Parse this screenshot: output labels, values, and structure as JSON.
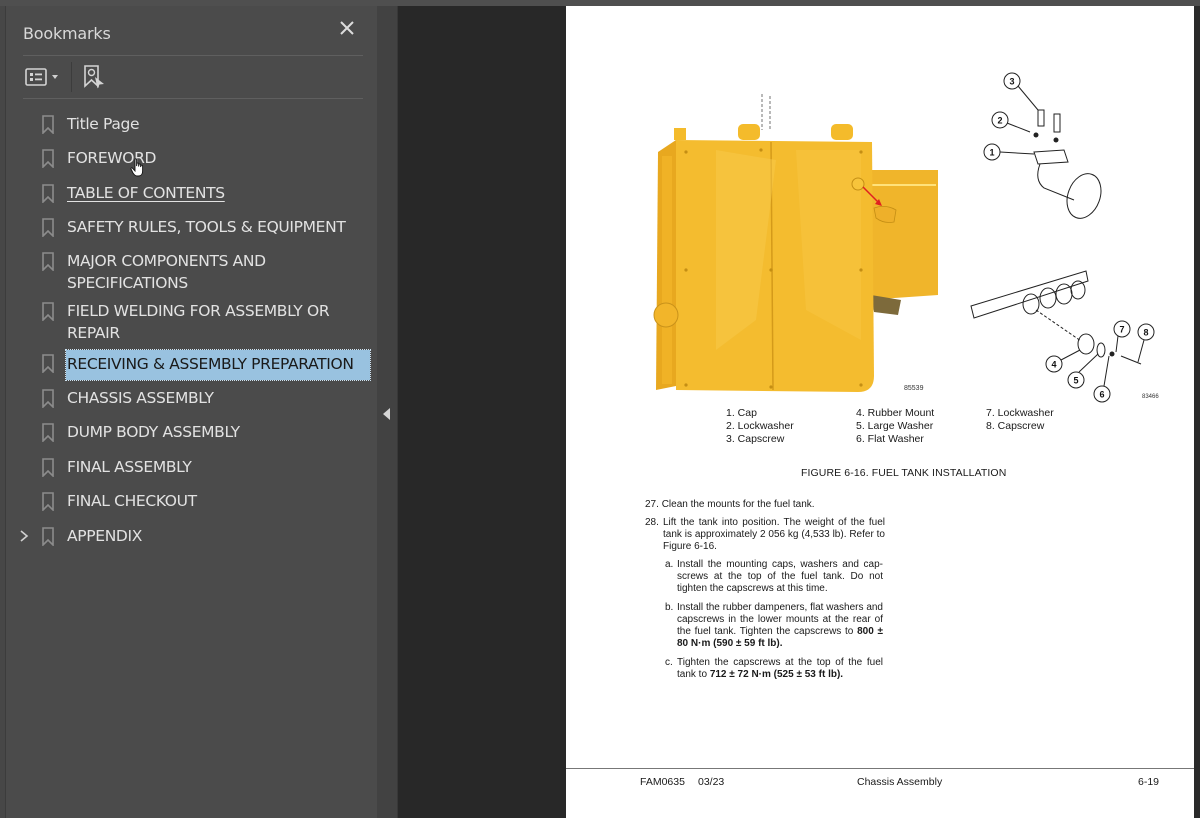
{
  "panel": {
    "title": "Bookmarks",
    "close_icon": "close-icon",
    "toolbar": {
      "options_icon": "list-options-icon",
      "options_dropdown_icon": "caret-down-icon",
      "find_icon": "find-current-bookmark-icon"
    }
  },
  "bookmarks": [
    {
      "label": "Title Page",
      "state": "normal"
    },
    {
      "label": "FOREWORD",
      "state": "hover"
    },
    {
      "label": "TABLE OF CONTENTS",
      "state": "underlined"
    },
    {
      "label": "SAFETY RULES, TOOLS & EQUIPMENT",
      "state": "normal"
    },
    {
      "label": "MAJOR COMPONENTS AND\nSPECIFICATIONS",
      "state": "normal"
    },
    {
      "label": "FIELD WELDING FOR ASSEMBLY OR\nREPAIR",
      "state": "normal"
    },
    {
      "label": "RECEIVING & ASSEMBLY PREPARATION",
      "state": "selected"
    },
    {
      "label": "CHASSIS ASSEMBLY",
      "state": "normal"
    },
    {
      "label": "DUMP BODY ASSEMBLY",
      "state": "normal"
    },
    {
      "label": "FINAL ASSEMBLY",
      "state": "normal"
    },
    {
      "label": "FINAL CHECKOUT",
      "state": "normal"
    },
    {
      "label": "APPENDIX",
      "state": "collapsed",
      "expander": "chevron-right-icon"
    }
  ],
  "colors": {
    "panel_bg": "#4b4b4b",
    "selected_bg": "#99c2e0",
    "doc_bg": "#282828",
    "tank_yellow": "#f2b92a"
  },
  "document": {
    "figure": {
      "photo_id": "85539",
      "diagram_id": "83466",
      "callouts": [
        "1",
        "2",
        "3",
        "4",
        "5",
        "6",
        "7",
        "8"
      ],
      "legend_col1": [
        "1. Cap",
        "2. Lockwasher",
        "3. Capscrew"
      ],
      "legend_col2": [
        "4. Rubber Mount",
        "5. Large Washer",
        "6. Flat Washer"
      ],
      "legend_col3": [
        "7. Lockwasher",
        "8. Capscrew"
      ],
      "caption": "FIGURE 6-16. FUEL TANK INSTALLATION"
    },
    "steps": {
      "s27_num": "27.",
      "s27_text": "Clean the mounts for the fuel tank.",
      "s28_num": "28.",
      "s28_text": "Lift the tank into position. The weight of the fuel tank is approximately 2 056 kg (4,533 lb). Refer to Figure 6-16.",
      "a_letter": "a.",
      "a_text": "Install the mounting caps, washers and cap-screws at the top of the fuel tank. Do not tighten the capscrews at this time.",
      "b_letter": "b.",
      "b_text": "Install the rubber dampeners, flat washers and capscrews in the lower mounts at the rear of the fuel tank. Tighten the capscrews to",
      "b_bold": "800 ± 80 N·m (590 ± 59 ft lb).",
      "c_letter": "c.",
      "c_text": "Tighten the capscrews at the top of the fuel tank to",
      "c_bold": "712 ± 72 N·m (525 ± 53 ft lb)."
    },
    "footer": {
      "doc_code": "FAM0635",
      "date": "03/23",
      "section": "Chassis Assembly",
      "page": "6-19"
    }
  }
}
